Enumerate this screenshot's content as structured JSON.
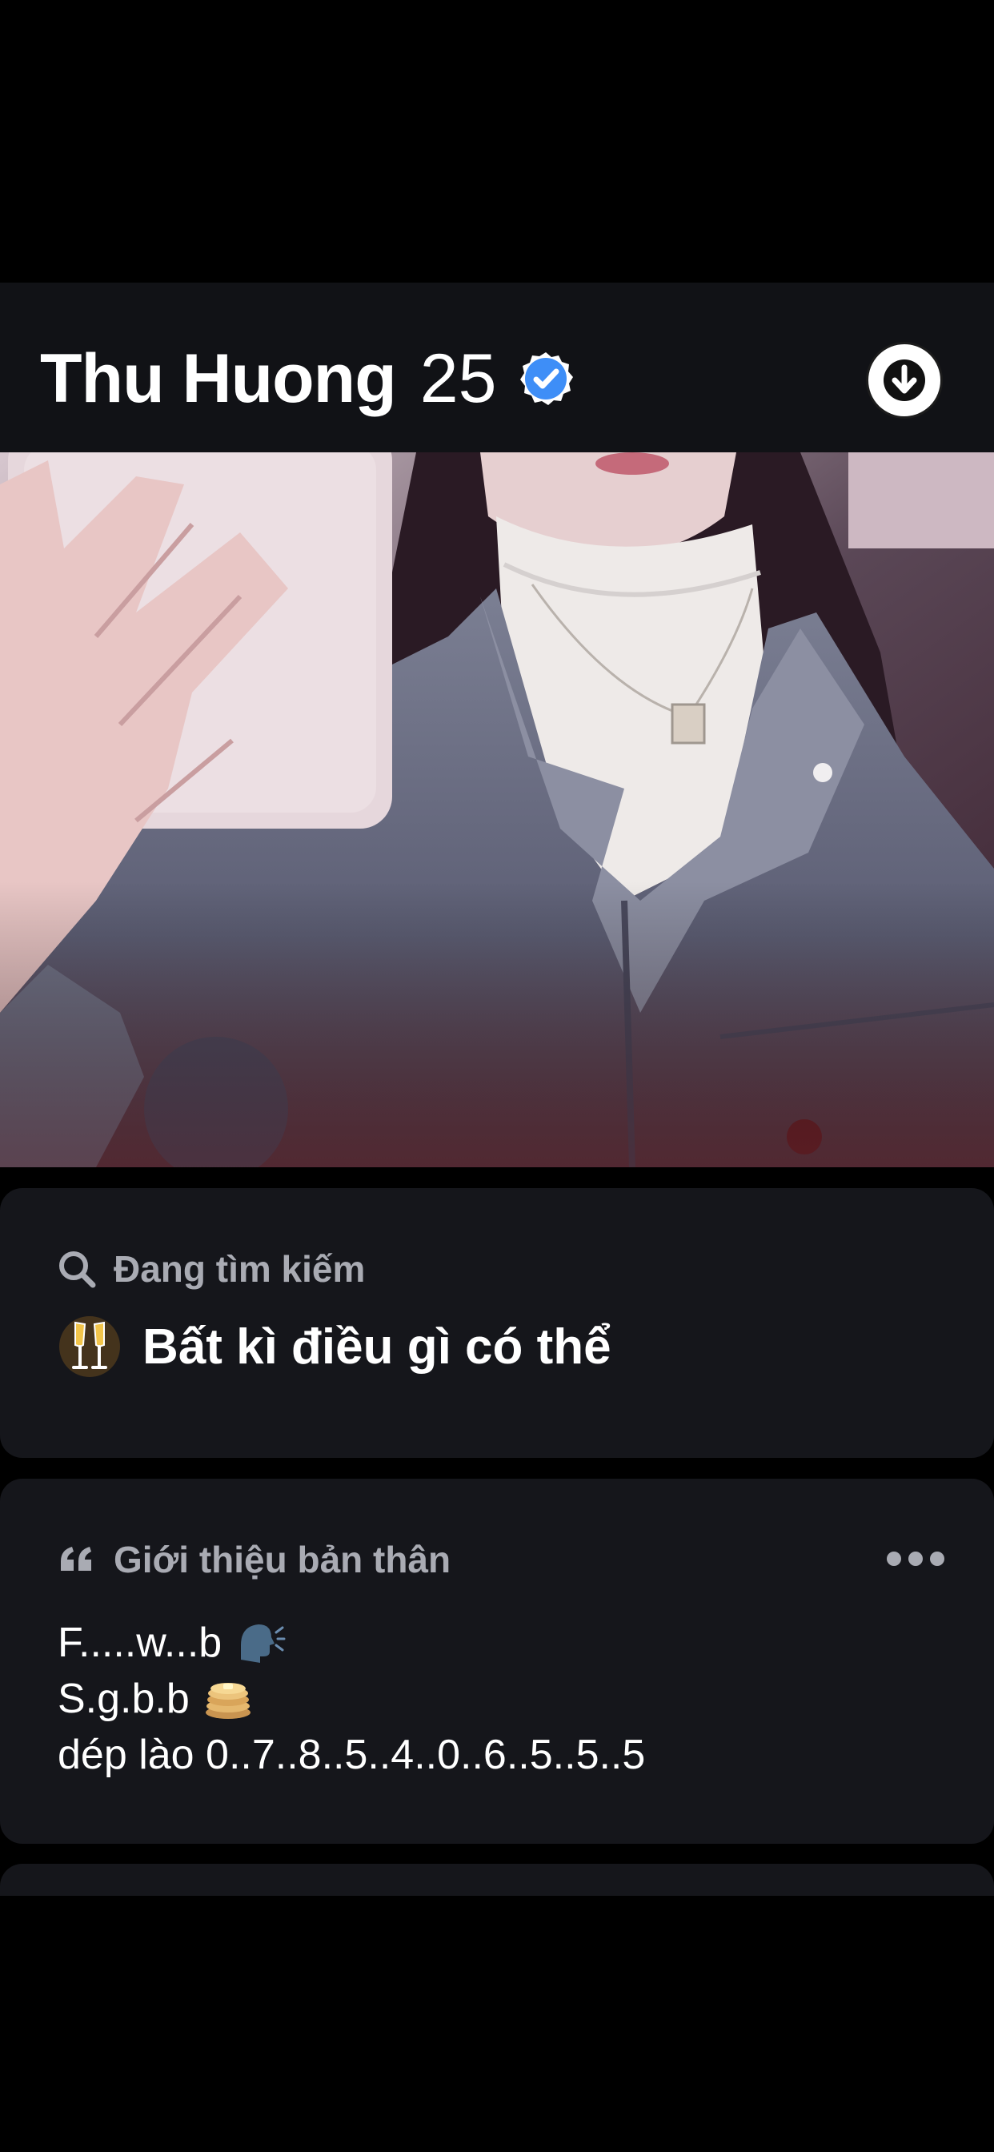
{
  "profile": {
    "name": "Thu Huong",
    "age": "25",
    "verified": true,
    "accent_color": "#3e8ef7"
  },
  "photo": {
    "icon": "profile-photo"
  },
  "looking_for": {
    "title": "Đang tìm kiếm",
    "icon": "search-icon",
    "emoji": "champagne-glasses-icon",
    "value": "Bất kì điều gì có thể"
  },
  "about": {
    "title": "Giới thiệu bản thân",
    "icon": "quote-icon",
    "more_icon": "more-dots-icon",
    "lines": [
      {
        "text": "F.....w...b",
        "emoji": "speaking-head-icon"
      },
      {
        "text": "S.g.b.b",
        "emoji": "pancakes-icon"
      },
      {
        "text": "dép lào 0..7..8..5..4..0..6..5..5..5",
        "emoji": ""
      }
    ]
  },
  "colors": {
    "background": "#000000",
    "card": "#15161b",
    "header": "#111216",
    "muted_text": "#a9abb3"
  }
}
